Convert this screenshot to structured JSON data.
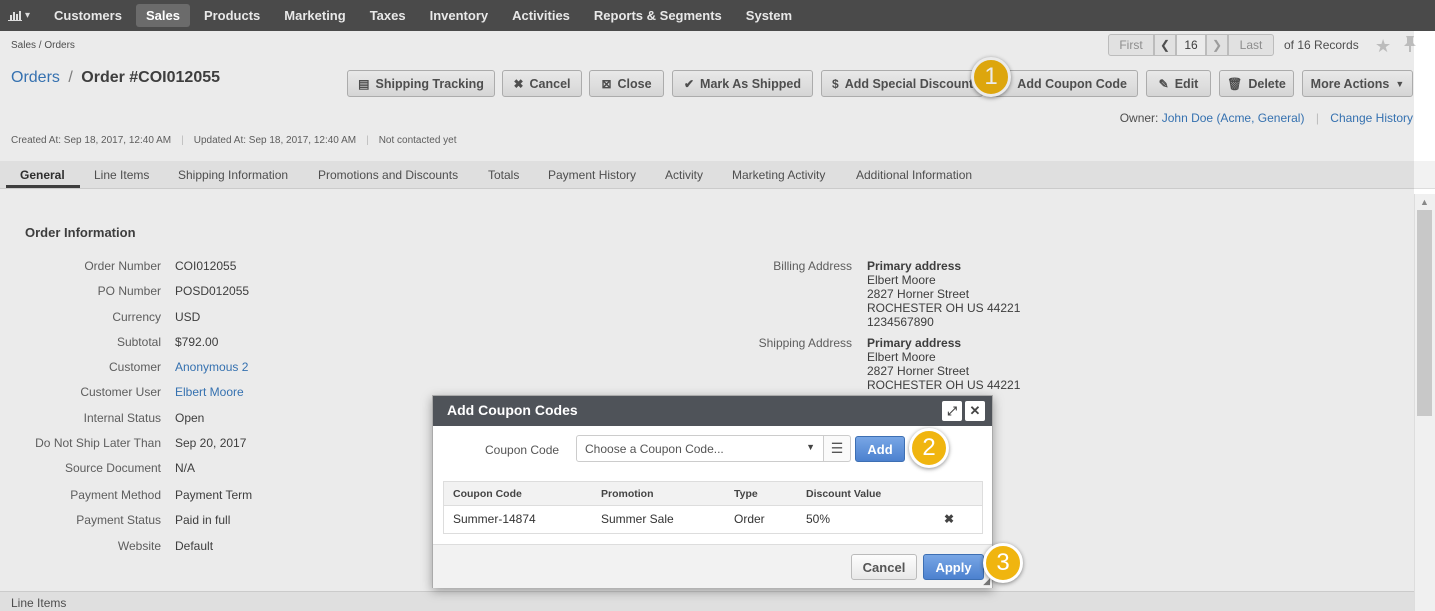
{
  "nav": {
    "items": [
      {
        "label": "Customers"
      },
      {
        "label": "Sales"
      },
      {
        "label": "Products"
      },
      {
        "label": "Marketing"
      },
      {
        "label": "Taxes"
      },
      {
        "label": "Inventory"
      },
      {
        "label": "Activities"
      },
      {
        "label": "Reports & Segments"
      },
      {
        "label": "System"
      }
    ],
    "active": "Sales"
  },
  "breadcrumb": "Sales / Orders",
  "pager": {
    "first": "First",
    "current": "16",
    "last": "Last",
    "records": "of 16 Records"
  },
  "header": {
    "crumb": "Orders",
    "separator": "/",
    "title": "Order #COI012055"
  },
  "actions": {
    "shipping_tracking": "Shipping Tracking",
    "cancel": "Cancel",
    "close": "Close",
    "mark_as_shipped": "Mark As Shipped",
    "add_special_discount": "Add Special Discount",
    "add_coupon_code": "Add Coupon Code",
    "edit": "Edit",
    "delete": "Delete",
    "more_actions": "More Actions"
  },
  "badges": {
    "one": "1",
    "two": "2",
    "three": "3"
  },
  "owner": {
    "label": "Owner:",
    "name": "John Doe (Acme, General)",
    "change_history": "Change History"
  },
  "meta": {
    "created": "Created At: Sep 18, 2017, 12:40 AM",
    "updated": "Updated At: Sep 18, 2017, 12:40 AM",
    "contact": "Not contacted yet"
  },
  "tabs": [
    {
      "label": "General"
    },
    {
      "label": "Line Items"
    },
    {
      "label": "Shipping Information"
    },
    {
      "label": "Promotions and Discounts"
    },
    {
      "label": "Totals"
    },
    {
      "label": "Payment History"
    },
    {
      "label": "Activity"
    },
    {
      "label": "Marketing Activity"
    },
    {
      "label": "Additional Information"
    }
  ],
  "order_info": {
    "title": "Order Information",
    "fields": [
      {
        "label": "Order Number",
        "value": "COI012055"
      },
      {
        "label": "PO Number",
        "value": "POSD012055"
      },
      {
        "label": "Currency",
        "value": "USD"
      },
      {
        "label": "Subtotal",
        "value": "$792.00"
      },
      {
        "label": "Customer",
        "value": "Anonymous 2"
      },
      {
        "label": "Customer User",
        "value": "Elbert Moore"
      },
      {
        "label": "Internal Status",
        "value": "Open"
      },
      {
        "label": "Do Not Ship Later Than",
        "value": "Sep 20, 2017"
      },
      {
        "label": "Source Document",
        "value": "N/A"
      },
      {
        "label": "Payment Method",
        "value": "Payment Term"
      },
      {
        "label": "Payment Status",
        "value": "Paid in full"
      },
      {
        "label": "Website",
        "value": "Default"
      }
    ]
  },
  "billing": {
    "label": "Billing Address",
    "name": "Primary address",
    "lines": [
      "Elbert Moore",
      "2827 Horner Street",
      "ROCHESTER OH US 44221",
      "1234567890"
    ]
  },
  "shipping": {
    "label": "Shipping Address",
    "name": "Primary address",
    "lines": [
      "Elbert Moore",
      "2827 Horner Street",
      "ROCHESTER OH US 44221"
    ]
  },
  "footer_section": "Line Items",
  "modal": {
    "title": "Add Coupon Codes",
    "coupon_label": "Coupon Code",
    "select_placeholder": "Choose a Coupon Code...",
    "add": "Add",
    "columns": [
      "Coupon Code",
      "Promotion",
      "Type",
      "Discount Value"
    ],
    "rows": [
      {
        "code": "Summer-14874",
        "promotion": "Summer Sale",
        "type": "Order",
        "discount": "50%"
      }
    ],
    "cancel": "Cancel",
    "apply": "Apply"
  }
}
